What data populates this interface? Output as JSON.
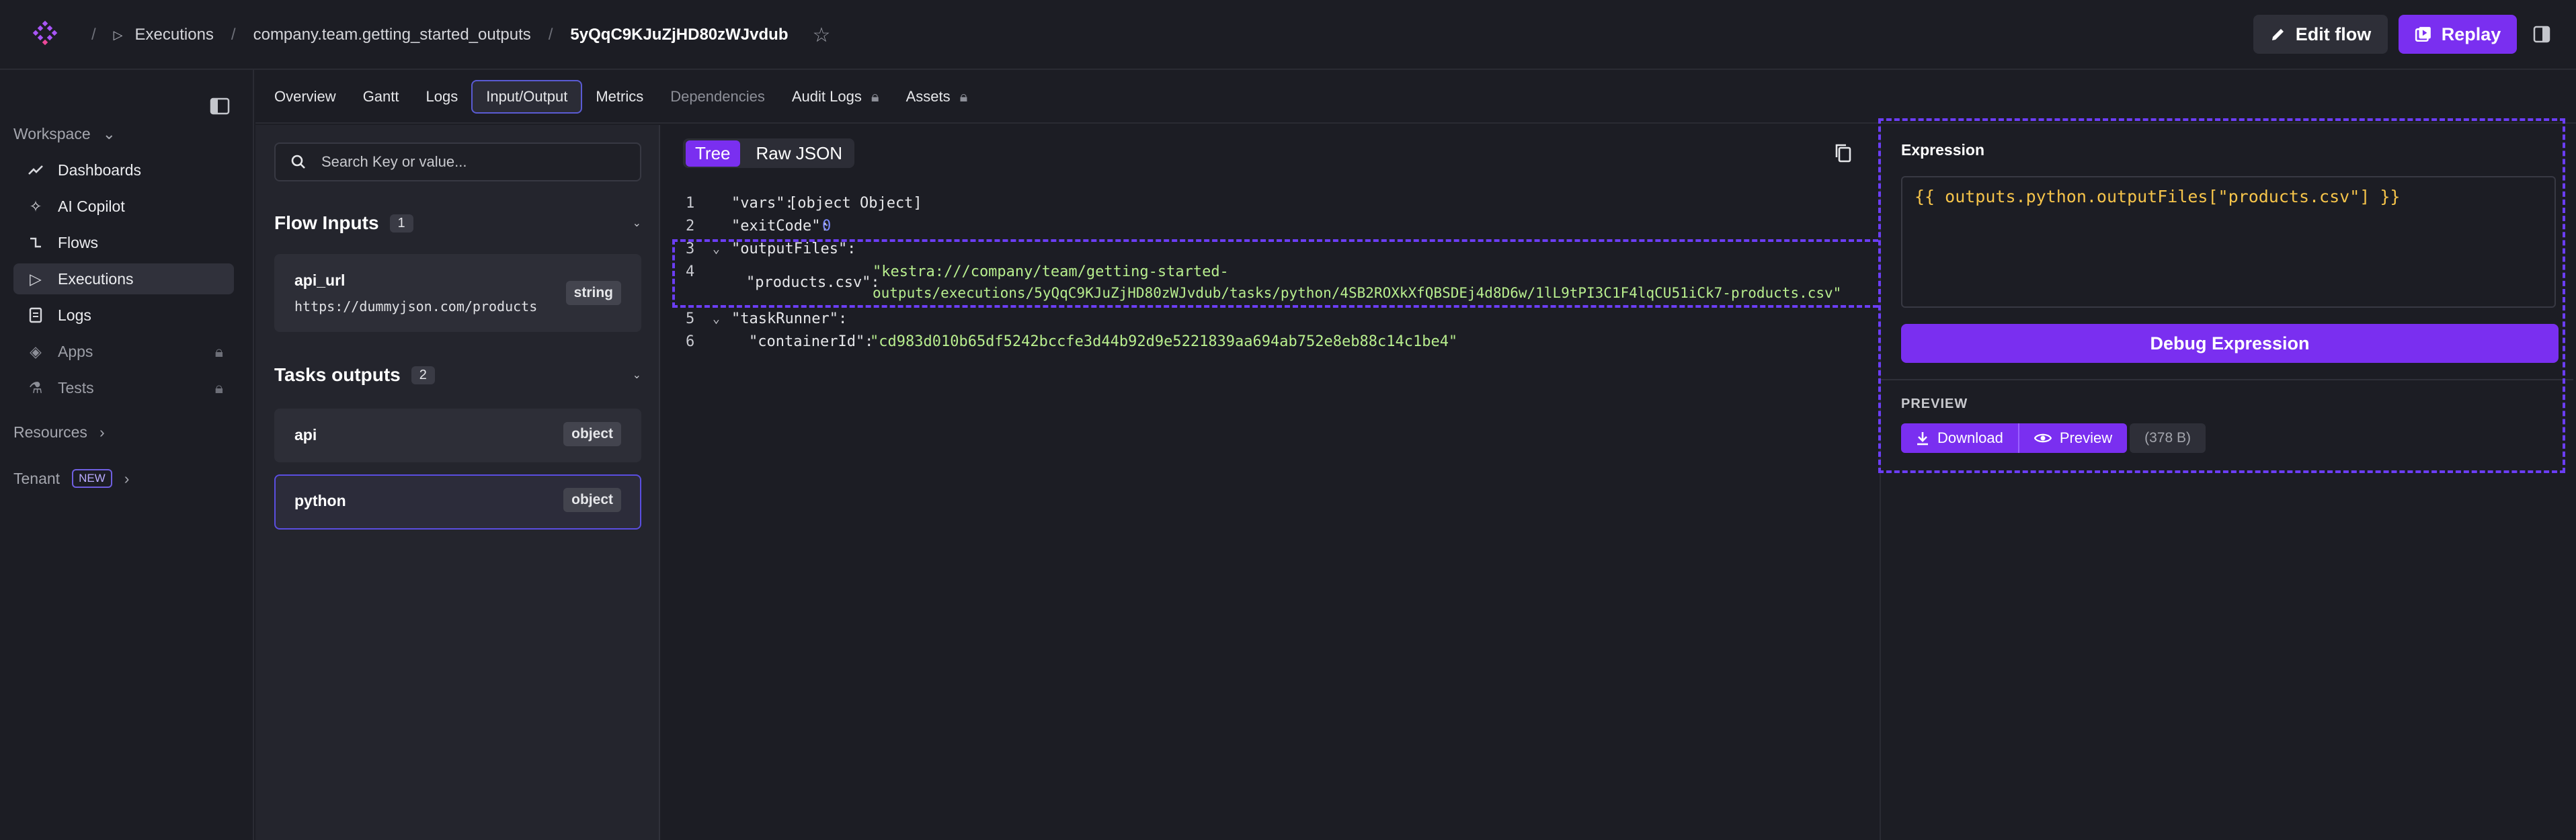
{
  "breadcrumb": {
    "items": [
      "Executions",
      "company.team.getting_started_outputs"
    ],
    "current": "5yQqC9KJuZjHD80zWJvdub"
  },
  "header": {
    "edit_label": "Edit flow",
    "replay_label": "Replay"
  },
  "sidebar": {
    "workspace_label": "Workspace",
    "items": [
      {
        "label": "Dashboards",
        "icon": "chart-line-icon"
      },
      {
        "label": "AI Copilot",
        "icon": "sparkle-icon"
      },
      {
        "label": "Flows",
        "icon": "flow-icon"
      },
      {
        "label": "Executions",
        "icon": "play-icon"
      },
      {
        "label": "Logs",
        "icon": "document-icon"
      },
      {
        "label": "Apps",
        "icon": "layers-icon"
      },
      {
        "label": "Tests",
        "icon": "flask-icon"
      }
    ],
    "resources_label": "Resources",
    "tenant_label": "Tenant",
    "tenant_badge": "NEW"
  },
  "tabs": [
    "Overview",
    "Gantt",
    "Logs",
    "Input/Output",
    "Metrics",
    "Dependencies",
    "Audit Logs",
    "Assets"
  ],
  "left": {
    "search_placeholder": "Search Key or value...",
    "flow_inputs": {
      "title": "Flow Inputs",
      "count": "1",
      "items": [
        {
          "name": "api_url",
          "value": "https://dummyjson.com/products",
          "type": "string"
        }
      ]
    },
    "task_outputs": {
      "title": "Tasks outputs",
      "count": "2",
      "items": [
        {
          "name": "api",
          "type": "object"
        },
        {
          "name": "python",
          "type": "object"
        }
      ]
    }
  },
  "center": {
    "view_tree": "Tree",
    "view_raw": "Raw JSON",
    "lines": [
      {
        "n": "1",
        "key": "\"vars\": ",
        "value": "[object Object]"
      },
      {
        "n": "2",
        "key": "\"exitCode\": ",
        "value": "0"
      },
      {
        "n": "3",
        "key": "\"outputFiles\":",
        "value": ""
      },
      {
        "n": "4",
        "key": "\"products.csv\": ",
        "value_line1": "\"kestra:///company/team/getting-started-",
        "value_line2": "outputs/executions/5yQqC9KJuZjHD80zWJvdub/tasks/python/4SB2ROXkXfQBSDEj4d8D6w/1lL9tPI3C1F4lqCU51iCk7-products.csv\""
      },
      {
        "n": "5",
        "key": "\"taskRunner\":",
        "value": ""
      },
      {
        "n": "6",
        "key": "\"containerId\": ",
        "value": "\"cd983d010b65df5242bccfe3d44b92d9e5221839aa694ab752e8eb88c14c1be4\""
      }
    ]
  },
  "right": {
    "expression_label": "Expression",
    "expression_value": "{{ outputs.python.outputFiles[\"products.csv\"] }}",
    "debug_label": "Debug Expression",
    "preview_label": "PREVIEW",
    "download_label": "Download",
    "preview_button": "Preview",
    "size": "(378 B)"
  }
}
